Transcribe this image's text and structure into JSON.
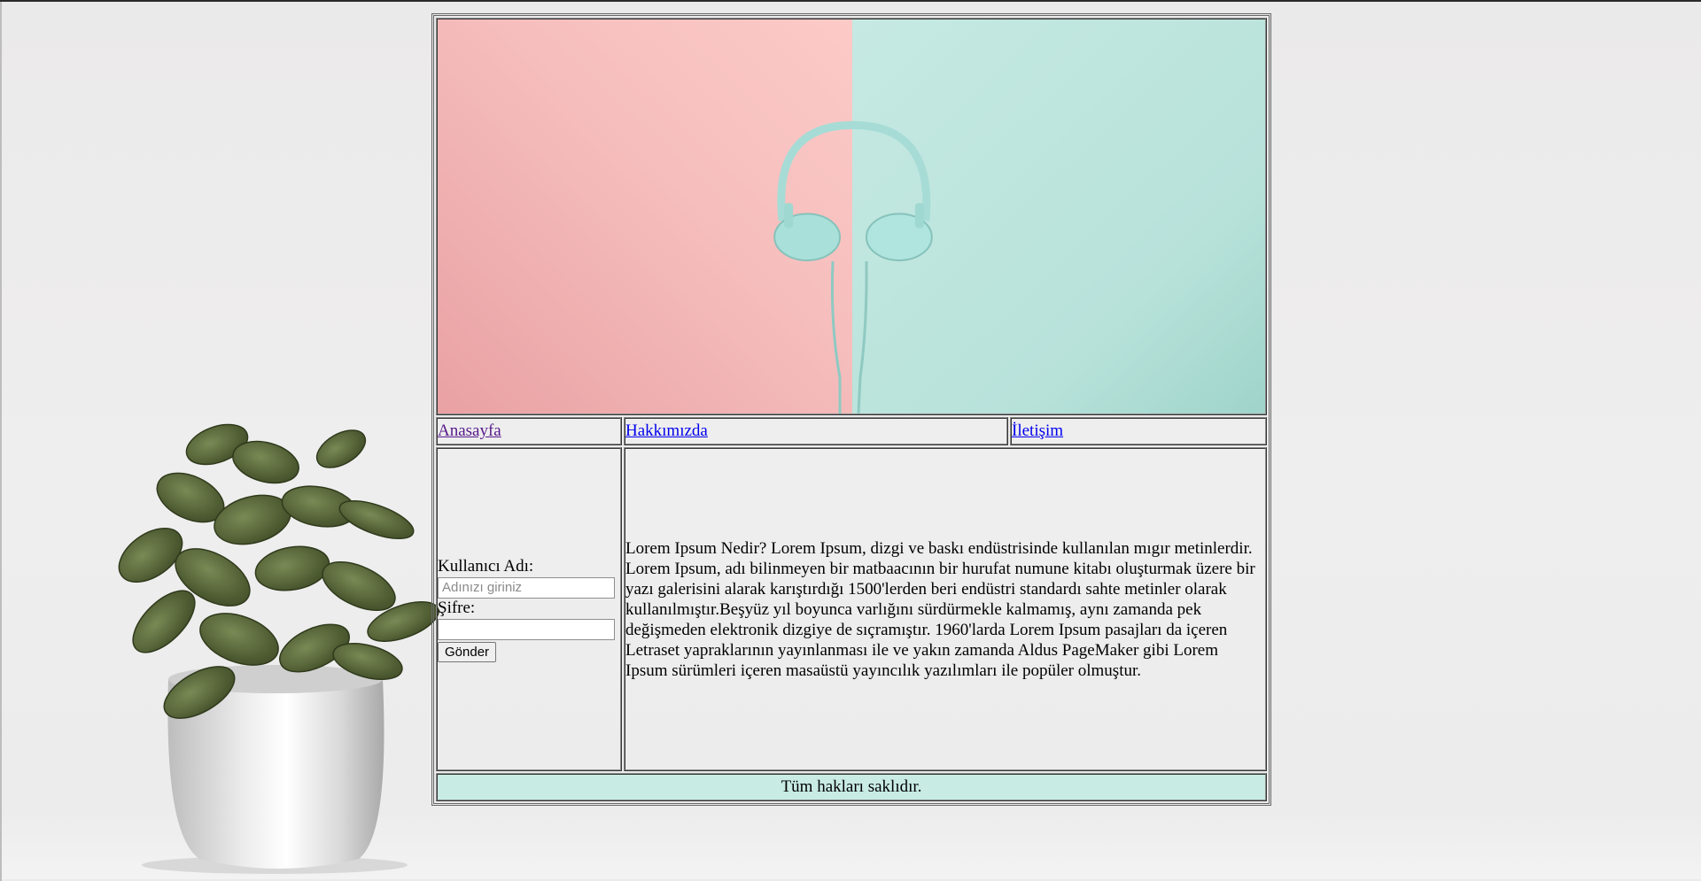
{
  "colors": {
    "banner_pink": "#f6c0bf",
    "banner_mint": "#bfe6df",
    "footer_bg": "#c8ebe3",
    "link": "#0000ee",
    "link_visited": "#551a8b"
  },
  "banner": {
    "icon": "headphones-image"
  },
  "nav": {
    "items": [
      {
        "label": "Anasayfa"
      },
      {
        "label": "Hakkımızda"
      },
      {
        "label": "İletişim"
      }
    ]
  },
  "login": {
    "username_label": "Kullanıcı Adı:",
    "username_placeholder": "Adınızı giriniz",
    "username_value": "",
    "password_label": "Şifre:",
    "password_value": "",
    "submit_label": "Gönder"
  },
  "content": {
    "text": "Lorem Ipsum Nedir? Lorem Ipsum, dizgi ve baskı endüstrisinde kullanılan mıgır metinlerdir. Lorem Ipsum, adı bilinmeyen bir matbaacının bir hurufat numune kitabı oluşturmak üzere bir yazı galerisini alarak karıştırdığı 1500'lerden beri endüstri standardı sahte metinler olarak kullanılmıştır.Beşyüz yıl boyunca varlığını sürdürmekle kalmamış, aynı zamanda pek değişmeden elektronik dizgiye de sıçramıştır. 1960'larda Lorem Ipsum pasajları da içeren Letraset yapraklarının yayınlanması ile ve yakın zamanda Aldus PageMaker gibi Lorem Ipsum sürümleri içeren masaüstü yayıncılık yazılımları ile popüler olmuştur."
  },
  "footer": {
    "text": "Tüm hakları saklıdır."
  }
}
